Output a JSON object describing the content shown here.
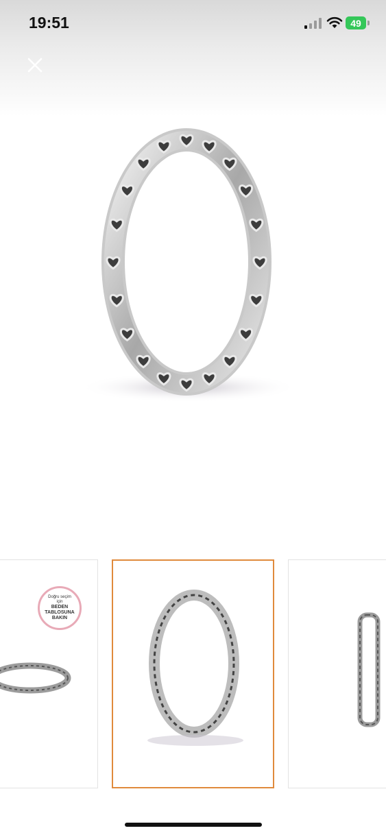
{
  "status_bar": {
    "time": "19:51",
    "battery_level": "49",
    "battery_color": "#34c759"
  },
  "header": {
    "close_icon": "close-icon"
  },
  "gallery": {
    "selected_index": 1,
    "accent_color": "#e08a3c",
    "thumbnails": [
      {
        "badge": {
          "line1": "Doğru seçim",
          "line2": "için",
          "line3": "BEDEN",
          "line4": "TABLOSUNA",
          "line5": "BAKIN"
        }
      },
      {},
      {}
    ]
  }
}
